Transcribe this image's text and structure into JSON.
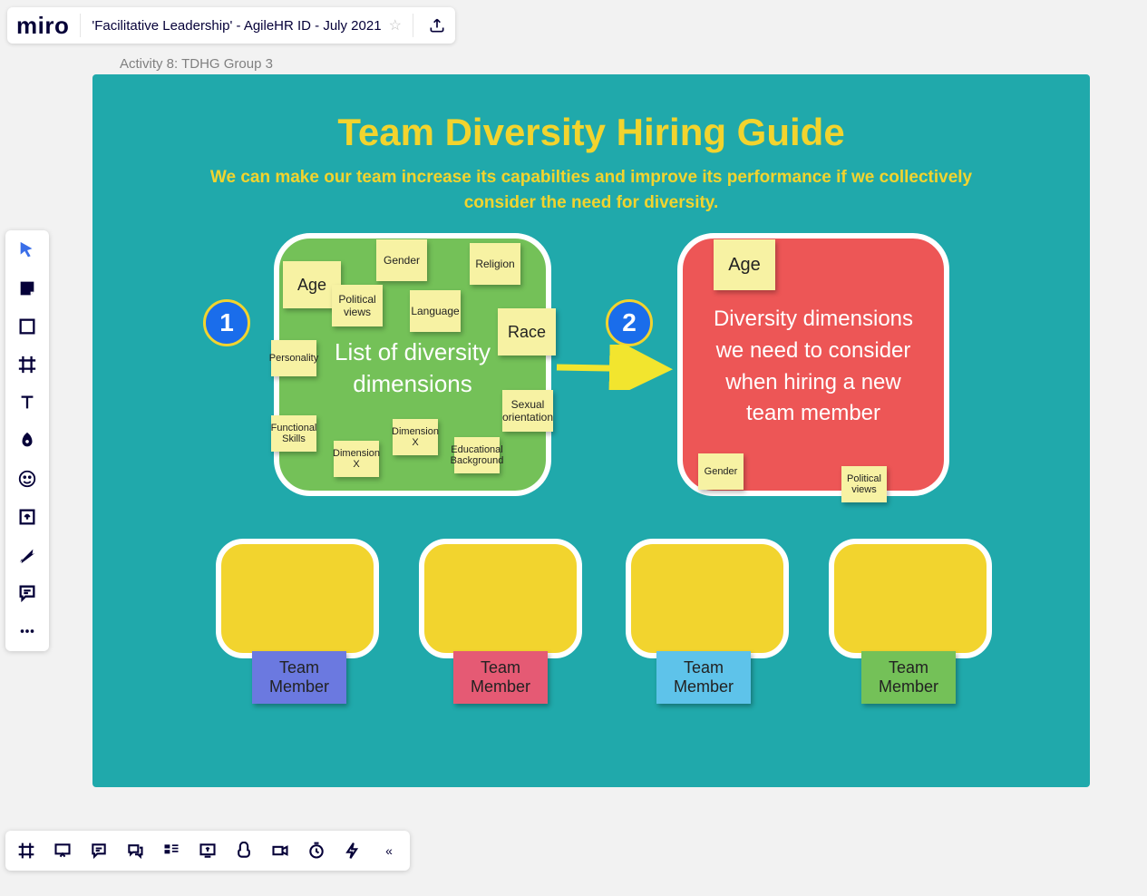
{
  "header": {
    "logo": "miro",
    "board_title": "'Facilitative Leadership' - AgileHR ID - July 2021"
  },
  "breadcrumb": "Activity 8: TDHG Group 3",
  "canvas": {
    "title": "Team Diversity Hiring Guide",
    "subtitle": "We can make our team increase its capabilties and improve its performance if we collectively consider the need for diversity.",
    "step1_badge": "1",
    "step2_badge": "2",
    "box1_title": "List of diversity dimensions",
    "box2_title": "Diversity dimensions we need to consider when hiring a new team member",
    "box1_stickies": {
      "gender": "Gender",
      "religion": "Religion",
      "age": "Age",
      "political": "Political views",
      "language": "Language",
      "race": "Race",
      "personality": "Personality",
      "sexual": "Sexual orientation",
      "functional": "Functional Skills",
      "dimx1": "Dimension X",
      "dimx2": "Dimension X",
      "edu": "Educational Background"
    },
    "box2_stickies": {
      "age": "Age",
      "gender": "Gender",
      "political": "Political views"
    },
    "team_label": "Team Member",
    "team_colors": [
      "#6b79e0",
      "#e55a74",
      "#5ec3ea",
      "#74c158"
    ]
  }
}
